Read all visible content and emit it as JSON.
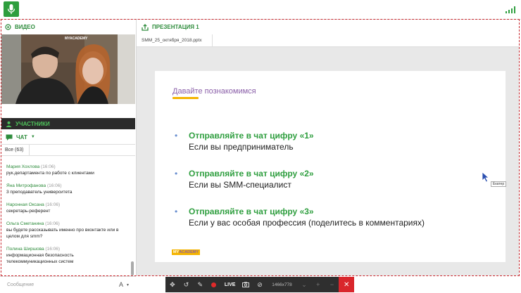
{
  "left_panel": {
    "video_section": {
      "title": "ВИДЕО"
    },
    "participants_section": {
      "title": "УЧАСТНИКИ"
    },
    "chat_section": {
      "title": "ЧАТ"
    },
    "chat_tab": {
      "label": "Все (63)"
    },
    "messages": [
      {
        "author": "Мария Хохлова",
        "time": "(16:06)",
        "text": [
          "рук.департамента по работе с клиентами"
        ]
      },
      {
        "author": "Яна Митрофанова",
        "time": "(16:06)",
        "text": [
          "3 преподаватель университета"
        ]
      },
      {
        "author": "Наронная Оксана",
        "time": "(16:06)",
        "text": [
          "секретарь-референт"
        ]
      },
      {
        "author": "Ольга Сметанина",
        "time": "(16:06)",
        "text": [
          "вы будете рассказывать именно про вконтакте или в",
          "целом для smm?"
        ]
      },
      {
        "author": "Полина Ширшова",
        "time": "(16:06)",
        "text": [
          "информационная безопасность",
          "телекоммуникационных систем"
        ]
      }
    ],
    "composer": {
      "placeholder": "Сообщение",
      "format_label": "A"
    },
    "video_logo": "MYACADEMY"
  },
  "presentation": {
    "section_title": "ПРЕЗЕНТАЦИЯ 1",
    "file_name": "SMM_25_октября_2018.pptx",
    "slide": {
      "title": "Давайте познакомимся",
      "bullets": [
        {
          "heading": "Отправляйте в чат цифру «1»",
          "sub": "Если вы предприниматель"
        },
        {
          "heading": "Отправляйте в чат цифру «2»",
          "sub": "Если вы SMM-специалист"
        },
        {
          "heading": "Отправляйте в чат цифру «3»",
          "sub": "Если у вас особая профессия (поделитесь в комментариях)"
        }
      ],
      "logo": {
        "part1": "MY",
        "part2": "ACADEMY"
      }
    },
    "cursor_label": "Екатер"
  },
  "toolbar": {
    "live_label": "LIVE",
    "resolution": "1466x778"
  },
  "colors": {
    "accent_green": "#2e9e3e",
    "title_purple": "#8a5fa8",
    "underline_yellow": "#f4b400",
    "close_red": "#d9262c"
  }
}
